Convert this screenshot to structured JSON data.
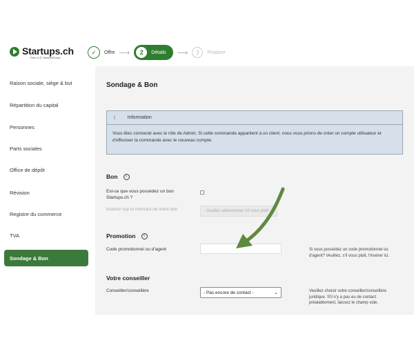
{
  "header": {
    "logo_name": "Startups.ch",
    "logo_sub": "Part of Ⓒ HelvetiaGroup",
    "steps": [
      {
        "number": "✓",
        "label": "Offre"
      },
      {
        "number": "2",
        "label": "Détails"
      },
      {
        "number": "3",
        "label": "Finaliser"
      }
    ]
  },
  "sidebar": {
    "items": [
      {
        "label": "Raison sociale, siège & but"
      },
      {
        "label": "Répartition du capital"
      },
      {
        "label": "Personnes"
      },
      {
        "label": "Parts sociales"
      },
      {
        "label": "Office de dépôt"
      },
      {
        "label": "Révision"
      },
      {
        "label": "Registre du commerce"
      },
      {
        "label": "TVA"
      },
      {
        "label": "Sondage & Bon"
      }
    ],
    "active_index": 8
  },
  "main": {
    "title": "Sondage & Bon",
    "info": {
      "icon": "i",
      "title": "Information",
      "text": "Vous êtes connecté avec le rôle de Admin. Si cette commande appartient à un client, nous vous prions de créer un compte utilisateur et d'effectuer la commande avec le nouveau compte."
    },
    "bon": {
      "title": "Bon",
      "question": "Est-ce que vous possédez un bon Startups.ch ?",
      "amount_label": "Insérez svp le montant de votre bon",
      "amount_placeholder": "- Veuillez sélectionner s'il vous plaît -"
    },
    "promotion": {
      "title": "Promotion",
      "code_label": "Code promotionnel ou d'agent",
      "code_value": "",
      "help": "Si vous possédez un code promotionnel ou d'agent? Veuillez, s'il vous plaît, l'insérer ici."
    },
    "conseiller": {
      "title": "Votre conseiller",
      "label": "Conseiller/conseillère",
      "selected": "- Pas encore de contact -",
      "help": "Veuillez choisir votre conseiller/conseillère juridique. S'il n'y a pas eu de contact préalablement, laissez le champ vide."
    }
  },
  "colors": {
    "brand_green": "#2f7d2f",
    "info_bg": "#d6e0ea",
    "arrow_green": "#5f8a3e"
  }
}
